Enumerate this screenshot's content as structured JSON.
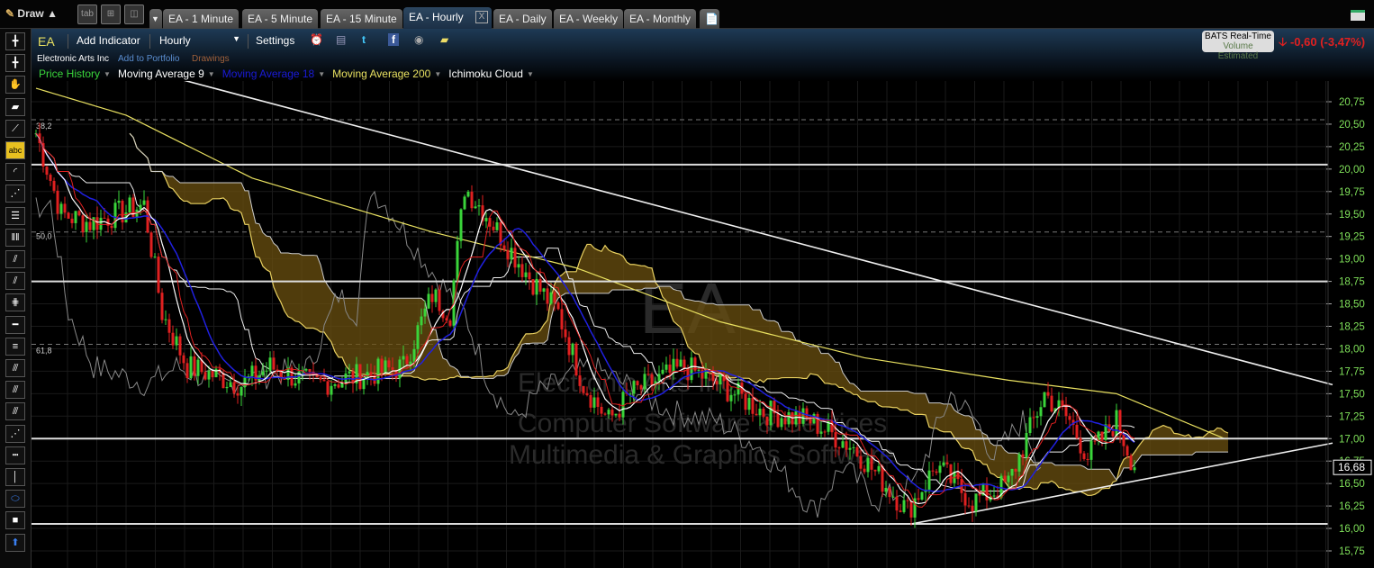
{
  "toolbar": {
    "draw_label": "Draw",
    "layout_tab_label": "tab"
  },
  "tabs": [
    {
      "label": "EA - 1 Minute",
      "active": false
    },
    {
      "label": "EA - 5 Minute",
      "active": false
    },
    {
      "label": "EA - 15 Minute",
      "active": false
    },
    {
      "label": "EA - Hourly",
      "active": true
    },
    {
      "label": "EA - Daily",
      "active": false
    },
    {
      "label": "EA - Weekly",
      "active": false
    },
    {
      "label": "EA - Monthly",
      "active": false
    }
  ],
  "header": {
    "symbol": "EA",
    "add_indicator": "Add Indicator",
    "interval": "Hourly",
    "settings": "Settings",
    "company": "Electronic Arts Inc",
    "add_portfolio": "Add to Portfolio",
    "drawings": "Drawings",
    "feed": "BATS Real-Time",
    "feed_note": "Volume Estimated",
    "change": "-0,60 (-3,47%)",
    "change_color": "#e02020"
  },
  "indicators": [
    {
      "label": "Price History",
      "color": "#3ad43a"
    },
    {
      "label": "Moving Average 9",
      "color": "#ffffff"
    },
    {
      "label": "Moving Average 18",
      "color": "#1a1ad8"
    },
    {
      "label": "Moving Average 200",
      "color": "#e8e060"
    },
    {
      "label": "Ichimoku Cloud",
      "color": "#ffffff"
    }
  ],
  "left_tools": [
    "crosshair",
    "crosshair-alt",
    "hand",
    "eraser",
    "line",
    "text-abc",
    "arc",
    "fan",
    "horizontal-lines",
    "vertical-lines",
    "parallel",
    "channel",
    "gann",
    "horizontal-line",
    "fib-retracement",
    "fib-fan",
    "pitchfork",
    "fib-arcs",
    "speed-lines",
    "dashed-lines",
    "vertical-line",
    "ellipse",
    "color-box",
    "arrow-up"
  ],
  "chart": {
    "watermark": {
      "symbol": "EA",
      "name": "Electronic Arts Inc",
      "sector": "Computer Software & Services",
      "industry": "Multimedia & Graphics Software"
    },
    "y_ticks": [
      "20,75",
      "20,50",
      "20,25",
      "20,00",
      "19,75",
      "19,50",
      "19,25",
      "19,00",
      "18,75",
      "18,50",
      "18,25",
      "18,00",
      "17,75",
      "17,50",
      "17,25",
      "17,00",
      "16,75",
      "16,50",
      "16,25",
      "16,00",
      "15,75"
    ],
    "last_price": "16,68",
    "fib_labels": [
      {
        "label": "38,2",
        "price": 20.48
      },
      {
        "label": "50,0",
        "price": 19.25
      },
      {
        "label": "61,8",
        "price": 17.98
      }
    ],
    "candle_up_color": "#3ad43a",
    "candle_down_color": "#e02020",
    "chart_data": {
      "type": "candlestick",
      "ylim": [
        15.6,
        21.0
      ],
      "close_path": [
        [
          0,
          20.4
        ],
        [
          7,
          19.5
        ],
        [
          15,
          19.4
        ],
        [
          30,
          19.6
        ],
        [
          35,
          18.4
        ],
        [
          42,
          17.8
        ],
        [
          50,
          17.7
        ],
        [
          57,
          17.6
        ],
        [
          65,
          17.8
        ],
        [
          77,
          17.6
        ],
        [
          90,
          17.7
        ],
        [
          102,
          17.8
        ],
        [
          110,
          18.6
        ],
        [
          115,
          18.4
        ],
        [
          119,
          19.8
        ],
        [
          125,
          19.5
        ],
        [
          130,
          19.2
        ],
        [
          137,
          18.8
        ],
        [
          145,
          18.4
        ],
        [
          152,
          17.6
        ],
        [
          159,
          17.2
        ],
        [
          165,
          17.5
        ],
        [
          175,
          17.7
        ],
        [
          180,
          17.8
        ],
        [
          190,
          17.6
        ],
        [
          202,
          17.3
        ],
        [
          215,
          17.2
        ],
        [
          227,
          16.9
        ],
        [
          242,
          16.2
        ],
        [
          250,
          16.7
        ],
        [
          260,
          16.3
        ],
        [
          270,
          16.5
        ],
        [
          280,
          17.5
        ],
        [
          287,
          17.2
        ],
        [
          292,
          16.8
        ],
        [
          300,
          17.2
        ],
        [
          305,
          16.68
        ]
      ],
      "ma200_path": [
        [
          0,
          20.9
        ],
        [
          25,
          20.6
        ],
        [
          60,
          19.9
        ],
        [
          110,
          19.3
        ],
        [
          150,
          18.9
        ],
        [
          190,
          18.3
        ],
        [
          230,
          17.9
        ],
        [
          270,
          17.65
        ],
        [
          300,
          17.5
        ],
        [
          330,
          17.0
        ]
      ],
      "horizontal_levels": [
        20.05,
        18.75,
        17.0,
        16.05
      ],
      "dashed_levels": [
        20.55,
        19.3,
        18.05
      ],
      "trendlines": [
        [
          [
            40,
            21.0
          ],
          [
            360,
            17.6
          ]
        ],
        [
          [
            243,
            16.05
          ],
          [
            360,
            16.95
          ]
        ]
      ]
    }
  }
}
